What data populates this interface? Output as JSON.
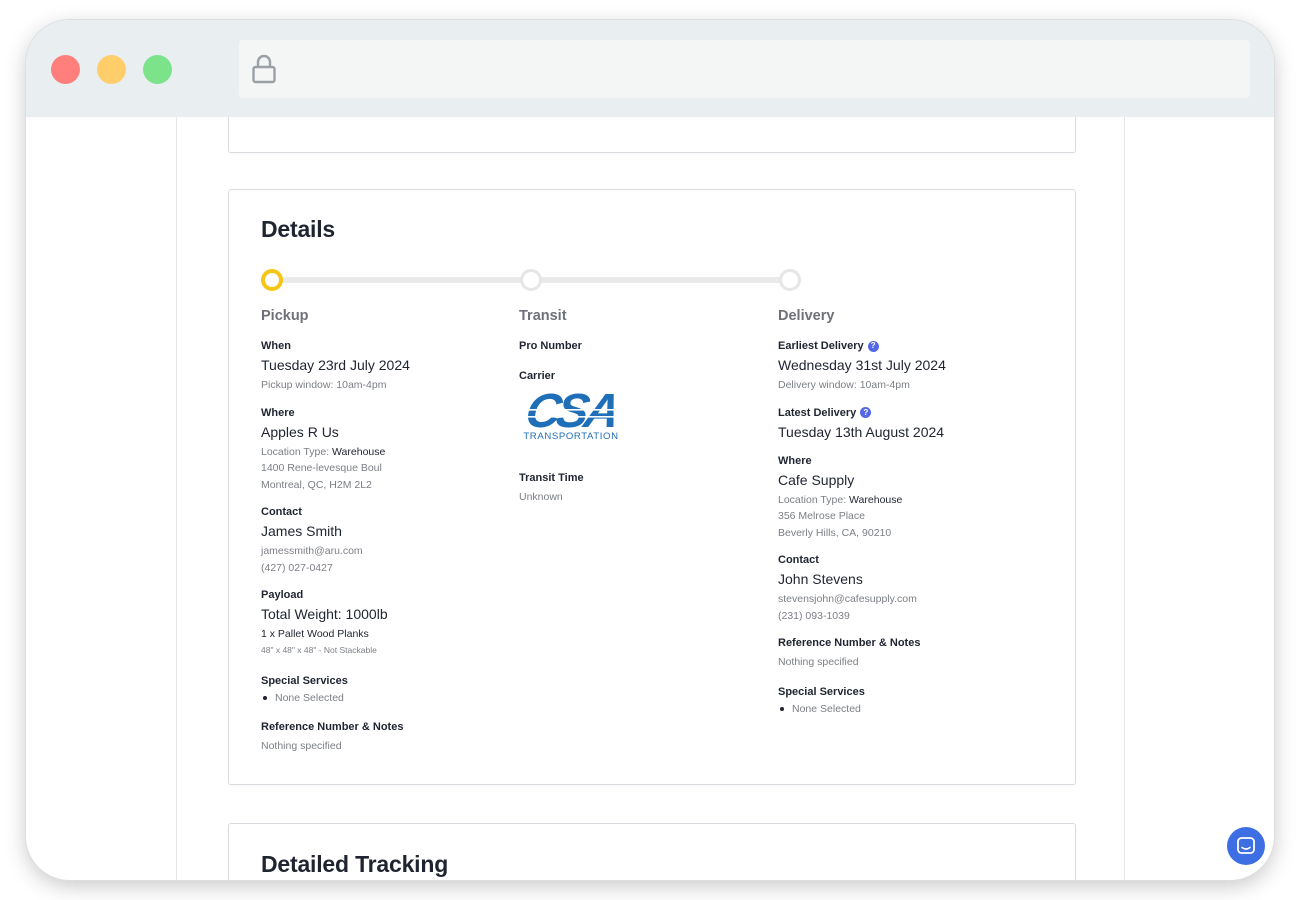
{
  "window": {
    "controls": [
      "close",
      "minimize",
      "maximize"
    ],
    "address_icon": "lock-icon"
  },
  "details": {
    "title": "Details",
    "progress_steps": 3,
    "active_step": 0,
    "pickup": {
      "heading": "Pickup",
      "when_label": "When",
      "when_value": "Tuesday 23rd July 2024",
      "window": "Pickup window: 10am-4pm",
      "where_label": "Where",
      "where_value": "Apples R Us",
      "location_type_label": "Location Type:",
      "location_type": "Warehouse",
      "address1": "1400 Rene-levesque Boul",
      "address2": "Montreal, QC, H2M 2L2",
      "contact_label": "Contact",
      "contact_name": "James Smith",
      "contact_email": "jamessmith@aru.com",
      "contact_phone": "(427) 027-0427",
      "payload_label": "Payload",
      "payload_weight": "Total Weight: 1000lb",
      "payload_item": "1 x Pallet Wood Planks",
      "payload_dims": "48\" x 48\" x 48\" - Not Stackable",
      "services_label": "Special Services",
      "services_value": "None Selected",
      "notes_label": "Reference Number & Notes",
      "notes_value": "Nothing specified"
    },
    "transit": {
      "heading": "Transit",
      "pro_label": "Pro Number",
      "carrier_label": "Carrier",
      "carrier_logo_text": "CSA",
      "carrier_logo_sub": "TRANSPORTATION",
      "transit_time_label": "Transit Time",
      "transit_time_value": "Unknown"
    },
    "delivery": {
      "heading": "Delivery",
      "earliest_label": "Earliest Delivery",
      "earliest_value": "Wednesday 31st July 2024",
      "window": "Delivery window: 10am-4pm",
      "latest_label": "Latest Delivery",
      "latest_value": "Tuesday 13th August 2024",
      "where_label": "Where",
      "where_value": "Cafe Supply",
      "location_type_label": "Location Type:",
      "location_type": "Warehouse",
      "address1": "356 Melrose Place",
      "address2": "Beverly Hills, CA, 90210",
      "contact_label": "Contact",
      "contact_name": "John Stevens",
      "contact_email": "stevensjohn@cafesupply.com",
      "contact_phone": "(231) 093-1039",
      "notes_label": "Reference Number & Notes",
      "notes_value": "Nothing specified",
      "services_label": "Special Services",
      "services_value": "None Selected"
    },
    "help_glyph": "?"
  },
  "tracking": {
    "title": "Detailed Tracking"
  },
  "colors": {
    "active_step": "#f5c518",
    "help": "#5468e7",
    "chat": "#3e6ee3"
  }
}
